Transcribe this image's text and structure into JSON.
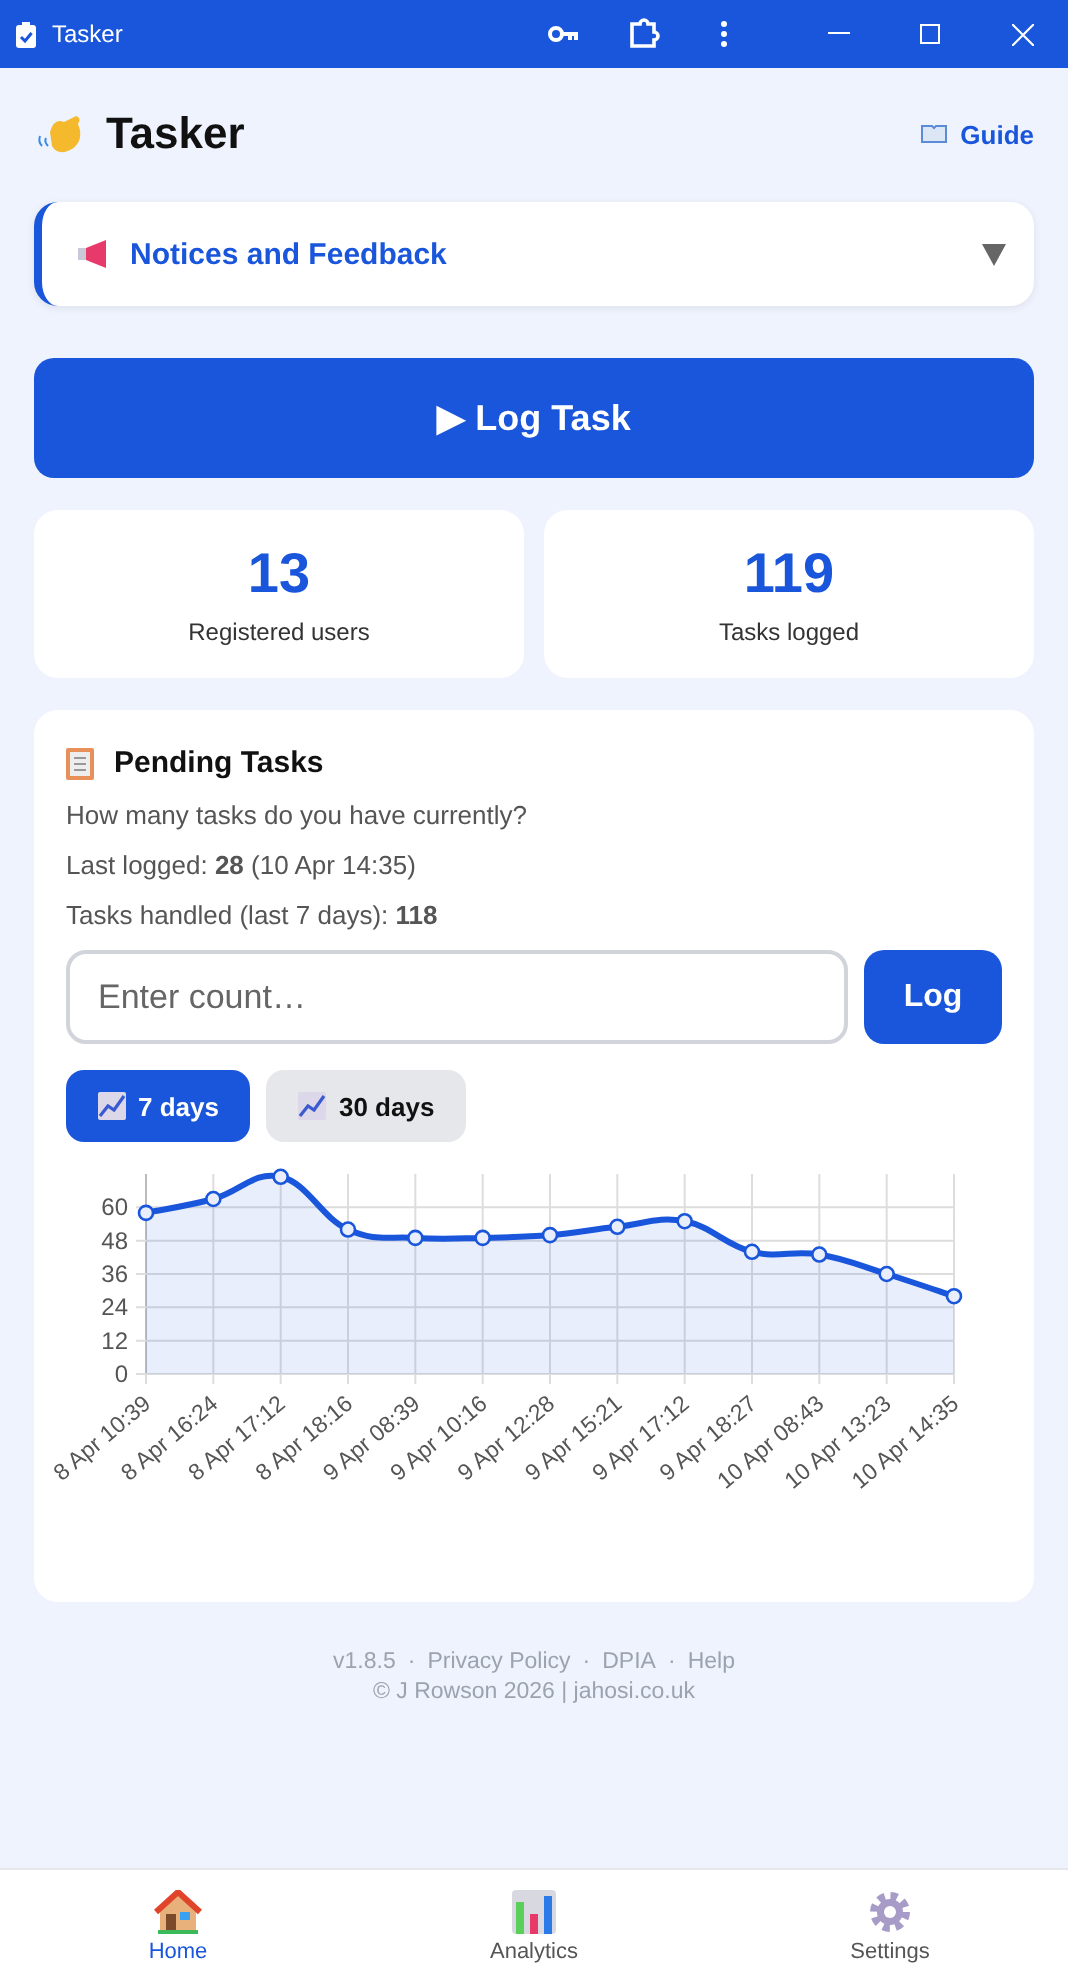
{
  "window": {
    "title": "Tasker"
  },
  "header": {
    "title": "Tasker",
    "guide_link": "Guide"
  },
  "notices": {
    "title": "Notices and Feedback",
    "expanded": false
  },
  "log_task_button": "▶ Log Task",
  "stats": [
    {
      "value": "13",
      "label": "Registered users"
    },
    {
      "value": "119",
      "label": "Tasks logged"
    }
  ],
  "pending": {
    "title": "Pending Tasks",
    "question": "How many tasks do you have currently?",
    "last_logged": "Last logged: **28** (10 Apr 14:35)",
    "handled": "Tasks handled (last 7 days): **118**",
    "input": {
      "placeholder": "Enter count…"
    },
    "log_button": "Log",
    "ranges": [
      {
        "label": "7 days",
        "selected": true
      },
      {
        "label": "30 days",
        "selected": false
      }
    ],
    "chart_data": {
      "type": "area",
      "categories": [
        "8 Apr 10:39",
        "8 Apr 16:24",
        "8 Apr 17:12",
        "8 Apr 18:16",
        "9 Apr 08:39",
        "9 Apr 10:16",
        "9 Apr 12:28",
        "9 Apr 15:21",
        "9 Apr 17:12",
        "9 Apr 18:27",
        "10 Apr 08:43",
        "10 Apr 13:23",
        "10 Apr 14:35"
      ],
      "series": [
        {
          "color": "#1a56db",
          "values": [
            58,
            63,
            71,
            52,
            49,
            49,
            50,
            53,
            55,
            44,
            43,
            36,
            28
          ]
        }
      ],
      "grid": true,
      "ylim": [
        0,
        72
      ],
      "yticks": [
        0,
        12,
        24,
        36,
        48,
        60
      ]
    }
  },
  "footer": {
    "version": "v1.8.5",
    "separators": [
      "·",
      "·",
      "·"
    ],
    "links": [
      "Privacy Policy",
      "DPIA",
      "Help"
    ],
    "copyright": "© J Rowson 2026 | jahosi.co.uk"
  },
  "nav": [
    {
      "kind": "home",
      "label": "Home",
      "selected": true
    },
    {
      "kind": "analytics",
      "label": "Analytics",
      "selected": false
    },
    {
      "kind": "settings",
      "label": "Settings",
      "selected": false
    }
  ]
}
